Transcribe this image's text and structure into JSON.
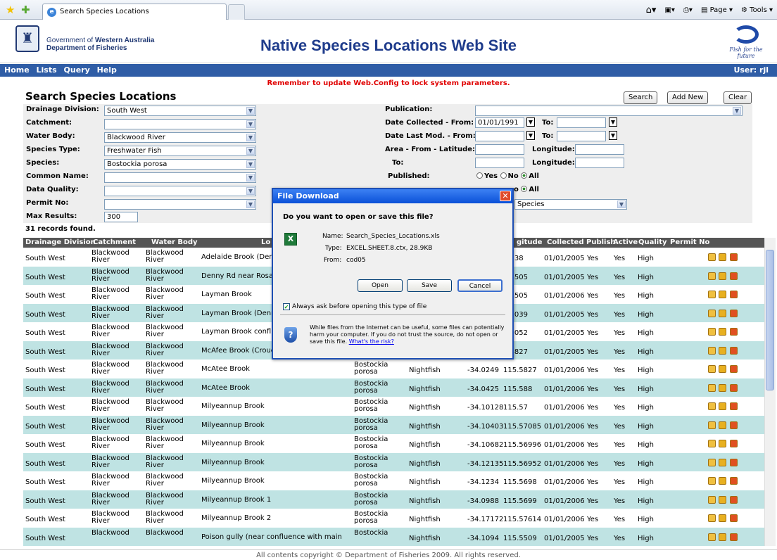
{
  "browser": {
    "tab_title": "Search Species Locations",
    "page_menu": "Page",
    "tools_menu": "Tools"
  },
  "header": {
    "gov_line1_a": "Government of",
    "gov_line1_b": "Western Australia",
    "gov_line2": "Department of Fisheries",
    "site_title": "Native Species Locations Web Site",
    "logo_tagline": "Fish for the future"
  },
  "nav": {
    "items": [
      "Home",
      "Lists",
      "Query",
      "Help"
    ],
    "user": "User: rjl"
  },
  "reminder": "Remember to update Web.Config to lock system parameters.",
  "page_title": "Search Species Locations",
  "buttons": {
    "search": "Search",
    "add_new": "Add New",
    "clear": "Clear"
  },
  "form": {
    "drainage_label": "Drainage Division:",
    "drainage_value": "South West",
    "catchment_label": "Catchment:",
    "catchment_value": "",
    "waterbody_label": "Water Body:",
    "waterbody_value": "Blackwood River",
    "speciestype_label": "Species Type:",
    "speciestype_value": "Freshwater Fish",
    "species_label": "Species:",
    "species_value": "Bostockia porosa",
    "commonname_label": "Common Name:",
    "commonname_value": "",
    "dataquality_label": "Data Quality:",
    "dataquality_value": "",
    "permit_label": "Permit No:",
    "permit_value": "",
    "maxresults_label": "Max Results:",
    "maxresults_value": "300",
    "publication_label": "Publication:",
    "publication_value": "",
    "datecollected_label": "Date Collected - From:",
    "datecollected_from": "01/01/1991",
    "to_label": "To:",
    "datecollected_to": "",
    "datelastmod_label": "Date Last Mod. - From:",
    "datelastmod_from": "",
    "datelastmod_to": "",
    "area_label": "Area - From - Latitude:",
    "lat_from": "",
    "longitude_label": "Longitude:",
    "lon_from": "",
    "to2_label": "To:",
    "lat_to": "",
    "lon_to": "",
    "published_label": "Published:",
    "yes": "Yes",
    "no": "No",
    "all": "All",
    "active_tail_no": "o",
    "active_all": "All",
    "species_option_tail": "Species"
  },
  "records_found": "31 records found.",
  "table": {
    "headers": [
      "Drainage Division",
      "Catchment",
      "Water Body",
      "Lo",
      "gitude",
      "Collected",
      "Publish",
      "Active",
      "Quality",
      "Permit No"
    ],
    "rows": [
      {
        "dd": "South West",
        "c1": "Blackwood",
        "c2": "River",
        "w1": "Blackwood",
        "w2": "River",
        "loc": "Adelaide Brook (Denn",
        "s1": "",
        "s2": "",
        "cn": "",
        "lat": "",
        "lon": "5.338",
        "col": "01/01/2005",
        "pub": "Yes",
        "act": "Yes",
        "q": "High"
      },
      {
        "dd": "South West",
        "c1": "Blackwood",
        "c2": "River",
        "w1": "Blackwood",
        "w2": "River",
        "loc": "Denny Rd near Rosa",
        "s1": "",
        "s2": "",
        "cn": "",
        "lat": "",
        "lon": "5.4505",
        "col": "01/01/2005",
        "pub": "Yes",
        "act": "Yes",
        "q": "High"
      },
      {
        "dd": "South West",
        "c1": "Blackwood",
        "c2": "River",
        "w1": "Blackwood",
        "w2": "River",
        "loc": "Layman Brook",
        "s1": "",
        "s2": "",
        "cn": "",
        "lat": "",
        "lon": "5.4505",
        "col": "01/01/2006",
        "pub": "Yes",
        "act": "Yes",
        "q": "High"
      },
      {
        "dd": "South West",
        "c1": "Blackwood",
        "c2": "River",
        "w1": "Blackwood",
        "w2": "River",
        "loc": "Layman Brook (Denny",
        "s1": "",
        "s2": "",
        "cn": "",
        "lat": "",
        "lon": "5.5039",
        "col": "01/01/2005",
        "pub": "Yes",
        "act": "Yes",
        "q": "High"
      },
      {
        "dd": "South West",
        "c1": "Blackwood",
        "c2": "River",
        "w1": "Blackwood",
        "w2": "River",
        "loc": "Layman Brook conflue",
        "s1": "",
        "s2": "",
        "cn": "",
        "lat": "",
        "lon": "5.5052",
        "col": "01/01/2005",
        "pub": "Yes",
        "act": "Yes",
        "q": "High"
      },
      {
        "dd": "South West",
        "c1": "Blackwood",
        "c2": "River",
        "w1": "Blackwood",
        "w2": "River",
        "loc": "McAfee Brook (Crouc",
        "s1": "",
        "s2": "",
        "cn": "",
        "lat": "",
        "lon": "5.5827",
        "col": "01/01/2005",
        "pub": "Yes",
        "act": "Yes",
        "q": "High"
      },
      {
        "dd": "South West",
        "c1": "Blackwood",
        "c2": "River",
        "w1": "Blackwood",
        "w2": "River",
        "loc": "McAtee Brook",
        "s1": "Bostockia",
        "s2": "porosa",
        "cn": "Nightfish",
        "lat": "-34.0249",
        "lon": "115.5827",
        "col": "01/01/2006",
        "pub": "Yes",
        "act": "Yes",
        "q": "High"
      },
      {
        "dd": "South West",
        "c1": "Blackwood",
        "c2": "River",
        "w1": "Blackwood",
        "w2": "River",
        "loc": "McAtee Brook",
        "s1": "Bostockia",
        "s2": "porosa",
        "cn": "Nightfish",
        "lat": "-34.0425",
        "lon": "115.588",
        "col": "01/01/2006",
        "pub": "Yes",
        "act": "Yes",
        "q": "High"
      },
      {
        "dd": "South West",
        "c1": "Blackwood",
        "c2": "River",
        "w1": "Blackwood",
        "w2": "River",
        "loc": "Milyeannup Brook",
        "s1": "Bostockia",
        "s2": "porosa",
        "cn": "Nightfish",
        "lat": "-34.10128",
        "lon": "115.57",
        "col": "01/01/2006",
        "pub": "Yes",
        "act": "Yes",
        "q": "High"
      },
      {
        "dd": "South West",
        "c1": "Blackwood",
        "c2": "River",
        "w1": "Blackwood",
        "w2": "River",
        "loc": "Milyeannup Brook",
        "s1": "Bostockia",
        "s2": "porosa",
        "cn": "Nightfish",
        "lat": "-34.10403",
        "lon": "115.57085",
        "col": "01/01/2006",
        "pub": "Yes",
        "act": "Yes",
        "q": "High"
      },
      {
        "dd": "South West",
        "c1": "Blackwood",
        "c2": "River",
        "w1": "Blackwood",
        "w2": "River",
        "loc": "Milyeannup Brook",
        "s1": "Bostockia",
        "s2": "porosa",
        "cn": "Nightfish",
        "lat": "-34.10682",
        "lon": "115.56996",
        "col": "01/01/2006",
        "pub": "Yes",
        "act": "Yes",
        "q": "High"
      },
      {
        "dd": "South West",
        "c1": "Blackwood",
        "c2": "River",
        "w1": "Blackwood",
        "w2": "River",
        "loc": "Milyeannup Brook",
        "s1": "Bostockia",
        "s2": "porosa",
        "cn": "Nightfish",
        "lat": "-34.12135",
        "lon": "115.56952",
        "col": "01/01/2006",
        "pub": "Yes",
        "act": "Yes",
        "q": "High"
      },
      {
        "dd": "South West",
        "c1": "Blackwood",
        "c2": "River",
        "w1": "Blackwood",
        "w2": "River",
        "loc": "Milyeannup Brook",
        "s1": "Bostockia",
        "s2": "porosa",
        "cn": "Nightfish",
        "lat": "-34.1234",
        "lon": "115.5698",
        "col": "01/01/2006",
        "pub": "Yes",
        "act": "Yes",
        "q": "High"
      },
      {
        "dd": "South West",
        "c1": "Blackwood",
        "c2": "River",
        "w1": "Blackwood",
        "w2": "River",
        "loc": "Milyeannup Brook 1",
        "s1": "Bostockia",
        "s2": "porosa",
        "cn": "Nightfish",
        "lat": "-34.0988",
        "lon": "115.5699",
        "col": "01/01/2006",
        "pub": "Yes",
        "act": "Yes",
        "q": "High"
      },
      {
        "dd": "South West",
        "c1": "Blackwood",
        "c2": "River",
        "w1": "Blackwood",
        "w2": "River",
        "loc": "Milyeannup Brook 2",
        "s1": "Bostockia",
        "s2": "porosa",
        "cn": "Nightfish",
        "lat": "-34.17172",
        "lon": "115.57614",
        "col": "01/01/2006",
        "pub": "Yes",
        "act": "Yes",
        "q": "High"
      },
      {
        "dd": "South West",
        "c1": "Blackwood",
        "c2": "",
        "w1": "Blackwood",
        "w2": "",
        "loc": "Poison gully (near confluence with main",
        "s1": "Bostockia",
        "s2": "",
        "cn": "Nightfish",
        "lat": "-34.1094",
        "lon": "115.5509",
        "col": "01/01/2005",
        "pub": "Yes",
        "act": "Yes",
        "q": "High"
      }
    ],
    "row_colors": [
      "#ffffff",
      "#bfe3e3"
    ]
  },
  "dialog": {
    "title": "File Download",
    "question": "Do you want to open or save this file?",
    "name_label": "Name:",
    "name_value": "Search_Species_Locations.xls",
    "type_label": "Type:",
    "type_value": "EXCEL.SHEET.8.ctx, 28.9KB",
    "from_label": "From:",
    "from_value": "cod05",
    "open": "Open",
    "save": "Save",
    "cancel": "Cancel",
    "always_ask": "Always ask before opening this type of file",
    "warning": "While files from the Internet can be useful, some files can potentially harm your computer. If you do not trust the source, do not open or save this file.",
    "risk_link": "What's the risk?"
  },
  "footer": "All contents copyright © Department of Fisheries 2009. All rights reserved."
}
